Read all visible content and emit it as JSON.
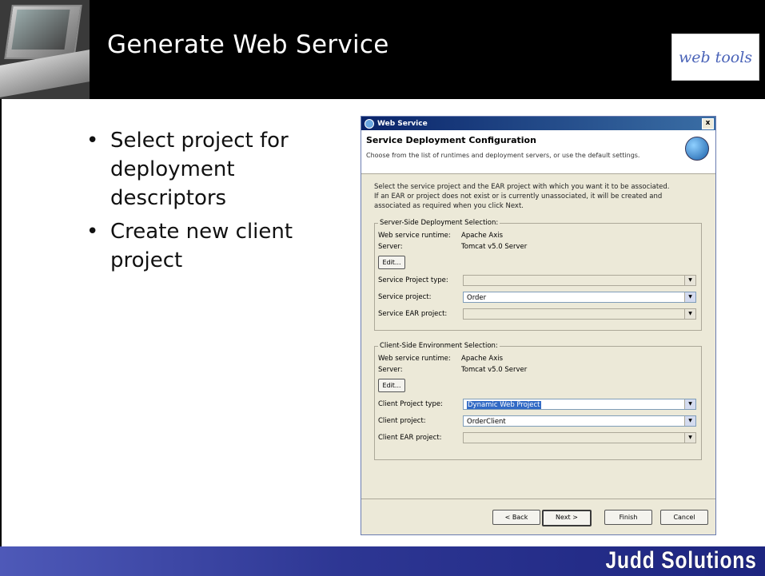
{
  "slide": {
    "title": "Generate Web Service",
    "logo_text": "web tools",
    "bullets": [
      "Select project for deployment descriptors",
      "Create new client project"
    ],
    "footer_brand": "Judd Solutions"
  },
  "dialog": {
    "window_title": "Web Service",
    "close_label": "x",
    "banner_title": "Service Deployment Configuration",
    "banner_desc": "Choose from the list of runtimes and deployment servers, or use the default settings.",
    "desc_line1": "Select the service project and the EAR project with which you want it to be associated.",
    "desc_line2": "If an EAR or project does not exist or is currently unassociated, it will be created and",
    "desc_line3": "associated as required when you click Next.",
    "server_group": {
      "legend": "Server-Side Deployment Selection:",
      "runtime_label": "Web service runtime:",
      "runtime_value": "Apache Axis",
      "server_label": "Server:",
      "server_value": "Tomcat v5.0 Server",
      "edit_label": "Edit...",
      "project_type_label": "Service Project type:",
      "project_type_value": "",
      "project_label": "Service project:",
      "project_value": "Order",
      "ear_label": "Service EAR project:",
      "ear_value": ""
    },
    "client_group": {
      "legend": "Client-Side Environment Selection:",
      "runtime_label": "Web service runtime:",
      "runtime_value": "Apache Axis",
      "server_label": "Server:",
      "server_value": "Tomcat v5.0 Server",
      "edit_label": "Edit...",
      "project_type_label": "Client Project type:",
      "project_type_value": "Dynamic Web Project",
      "project_label": "Client project:",
      "project_value": "OrderClient",
      "ear_label": "Client EAR project:",
      "ear_value": ""
    },
    "buttons": {
      "back": "< Back",
      "next": "Next >",
      "finish": "Finish",
      "cancel": "Cancel"
    }
  }
}
